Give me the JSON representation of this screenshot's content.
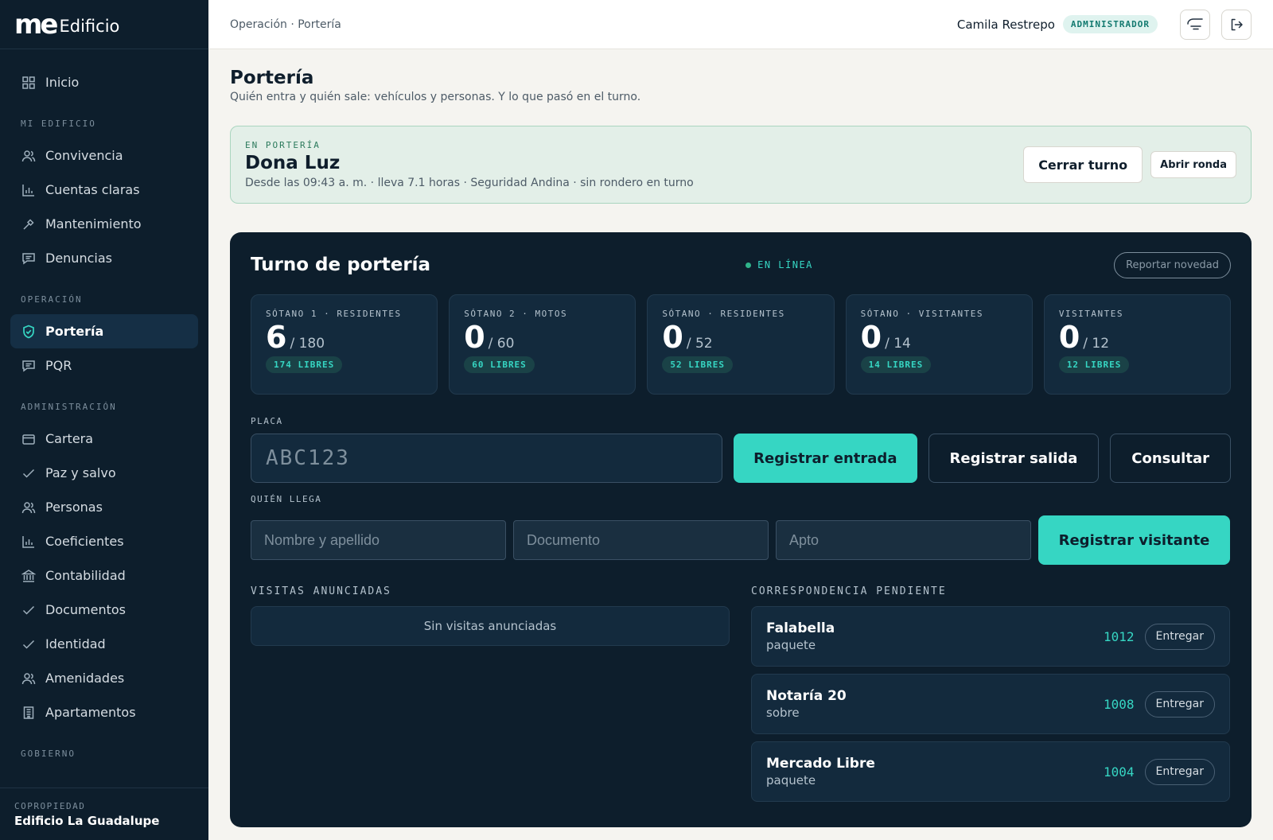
{
  "brand": {
    "mark": "me",
    "name": "Edificio"
  },
  "sidebar": {
    "home": {
      "label": "Inicio",
      "icon": "grid-icon"
    },
    "sections": [
      {
        "title": "MI EDIFICIO",
        "items": [
          {
            "label": "Convivencia",
            "icon": "people-icon"
          },
          {
            "label": "Cuentas claras",
            "icon": "bar-chart-icon"
          },
          {
            "label": "Mantenimiento",
            "icon": "wrench-icon"
          },
          {
            "label": "Denuncias",
            "icon": "message-icon"
          }
        ]
      },
      {
        "title": "OPERACIÓN",
        "items": [
          {
            "label": "Portería",
            "icon": "shield-icon",
            "active": true
          },
          {
            "label": "PQR",
            "icon": "message-icon"
          }
        ]
      },
      {
        "title": "ADMINISTRACIÓN",
        "items": [
          {
            "label": "Cartera",
            "icon": "wallet-icon"
          },
          {
            "label": "Paz y salvo",
            "icon": "check-icon"
          },
          {
            "label": "Personas",
            "icon": "people-icon"
          },
          {
            "label": "Coeficientes",
            "icon": "bar-chart-icon"
          },
          {
            "label": "Contabilidad",
            "icon": "bank-icon"
          },
          {
            "label": "Documentos",
            "icon": "check-icon"
          },
          {
            "label": "Identidad",
            "icon": "check-icon"
          },
          {
            "label": "Amenidades",
            "icon": "people-icon"
          },
          {
            "label": "Apartamentos",
            "icon": "building-icon"
          }
        ]
      },
      {
        "title": "GOBIERNO",
        "items": []
      }
    ],
    "footer": {
      "label": "COPROPIEDAD",
      "value": "Edificio La Guadalupe"
    }
  },
  "topbar": {
    "breadcrumb": "Operación · Portería",
    "user_name": "Camila Restrepo",
    "role": "ADMINISTRADOR"
  },
  "page": {
    "title": "Portería",
    "subtitle": "Quién entra y quién sale: vehículos y personas. Y lo que pasó en el turno."
  },
  "shift": {
    "label": "EN PORTERÍA",
    "guard_name": "Dona Luz",
    "meta": "Desde las 09:43 a. m. · lleva 7.1 horas · Seguridad Andina · sin rondero en turno",
    "close_label": "Cerrar turno",
    "round_label": "Abrir ronda"
  },
  "panel": {
    "title": "Turno de portería",
    "status": "EN LÍNEA",
    "report_label": "Reportar novedad",
    "stats": [
      {
        "label": "SÓTANO 1 · RESIDENTES",
        "used": "6",
        "capacity": "/ 180",
        "free": "174 LIBRES"
      },
      {
        "label": "SÓTANO 2 · MOTOS",
        "used": "0",
        "capacity": "/ 60",
        "free": "60 LIBRES"
      },
      {
        "label": "SÓTANO · RESIDENTES",
        "used": "0",
        "capacity": "/ 52",
        "free": "52 LIBRES"
      },
      {
        "label": "SÓTANO · VISITANTES",
        "used": "0",
        "capacity": "/ 14",
        "free": "14 LIBRES"
      },
      {
        "label": "VISITANTES",
        "used": "0",
        "capacity": "/ 12",
        "free": "12 LIBRES"
      }
    ],
    "plate": {
      "label": "PLACA",
      "placeholder": "ABC123",
      "value": "",
      "entry_label": "Registrar entrada",
      "exit_label": "Registrar salida",
      "query_label": "Consultar"
    },
    "visitor": {
      "label": "QUIÉN LLEGA",
      "name_placeholder": "Nombre y apellido",
      "doc_placeholder": "Documento",
      "apt_placeholder": "Apto",
      "register_label": "Registrar visitante"
    },
    "announced": {
      "label": "VISITAS ANUNCIADAS",
      "empty": "Sin visitas anunciadas"
    },
    "mail": {
      "label": "CORRESPONDENCIA PENDIENTE",
      "deliver_label": "Entregar",
      "items": [
        {
          "sender": "Falabella",
          "kind": "paquete",
          "apt": "1012"
        },
        {
          "sender": "Notaría 20",
          "kind": "sobre",
          "apt": "1008"
        },
        {
          "sender": "Mercado Libre",
          "kind": "paquete",
          "apt": "1004"
        }
      ]
    }
  },
  "colors": {
    "accent": "#36d6c3",
    "sidebar": "#0d1e2c",
    "panel": "#0d1e2c",
    "banner": "#e3efe8"
  }
}
